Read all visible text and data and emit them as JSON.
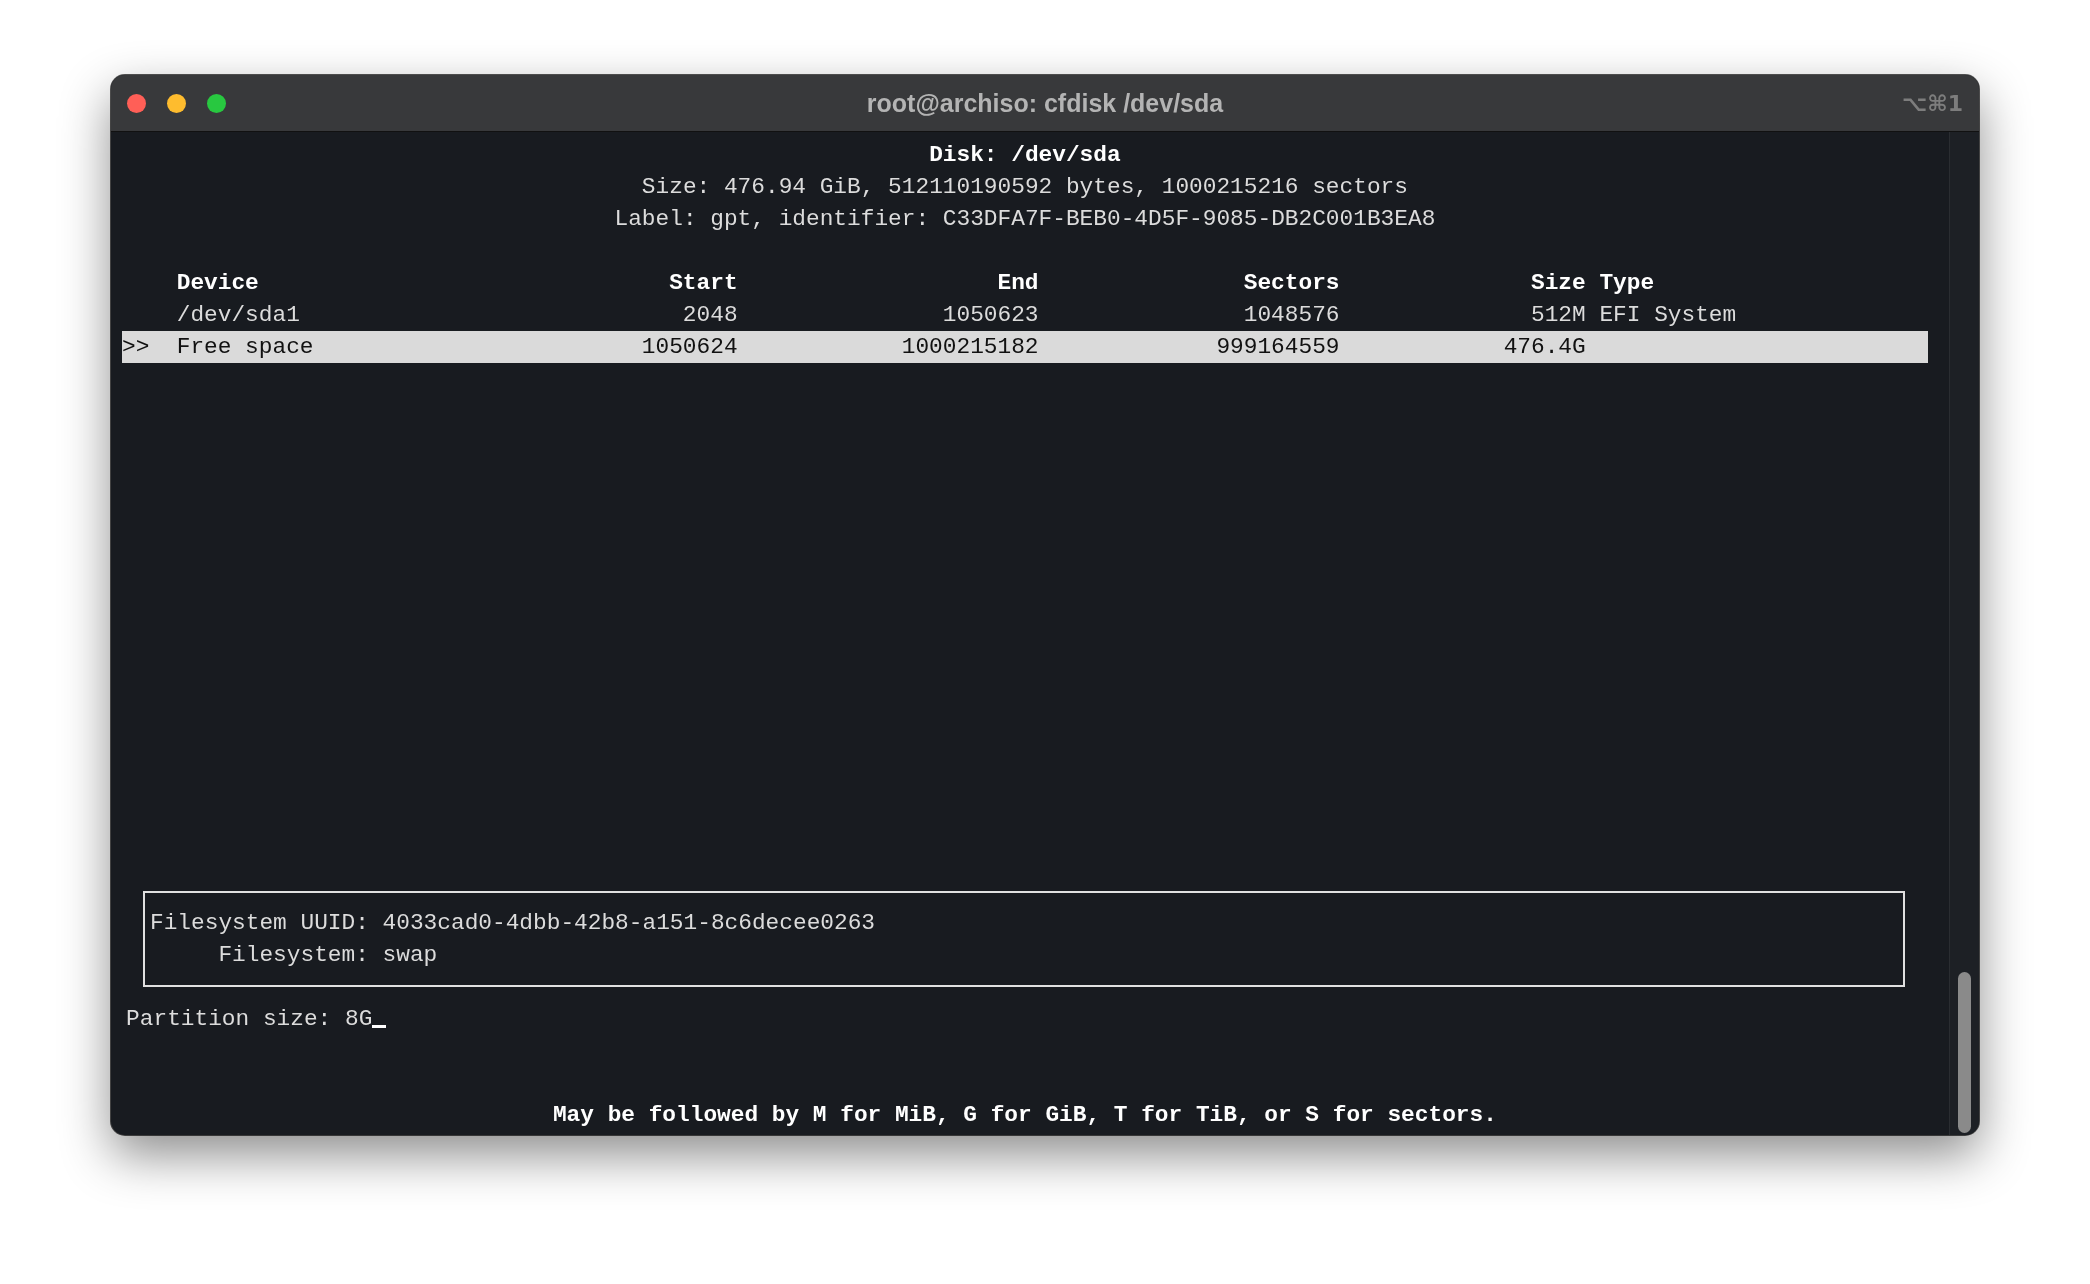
{
  "window": {
    "title": "root@archiso: cfdisk /dev/sda",
    "shortcut": "⌥⌘1"
  },
  "disk": {
    "heading": "Disk: /dev/sda",
    "size_line": "Size: 476.94 GiB, 512110190592 bytes, 1000215216 sectors",
    "label_line": "Label: gpt, identifier: C33DFA7F-BEB0-4D5F-9085-DB2C001B3EA8"
  },
  "table": {
    "columns": [
      "Device",
      "Start",
      "End",
      "Sectors",
      "Size",
      "Type"
    ],
    "rows": [
      {
        "selected": false,
        "cells": [
          "/dev/sda1",
          "2048",
          "1050623",
          "1048576",
          "512M",
          "EFI System"
        ]
      },
      {
        "selected": true,
        "marker": ">>",
        "cells": [
          "Free space",
          "1050624",
          "1000215182",
          "999164559",
          "476.4G"
        ]
      }
    ]
  },
  "info_box": {
    "lines": [
      {
        "label": "Filesystem UUID:",
        "value": "4033cad0-4dbb-42b8-a151-8c6decee0263"
      },
      {
        "label": "Filesystem:",
        "value": "swap"
      }
    ]
  },
  "prompt": {
    "label": "Partition size:",
    "value": "8G"
  },
  "hint": "May be followed by M for MiB, G for GiB, T for TiB, or S for sectors."
}
